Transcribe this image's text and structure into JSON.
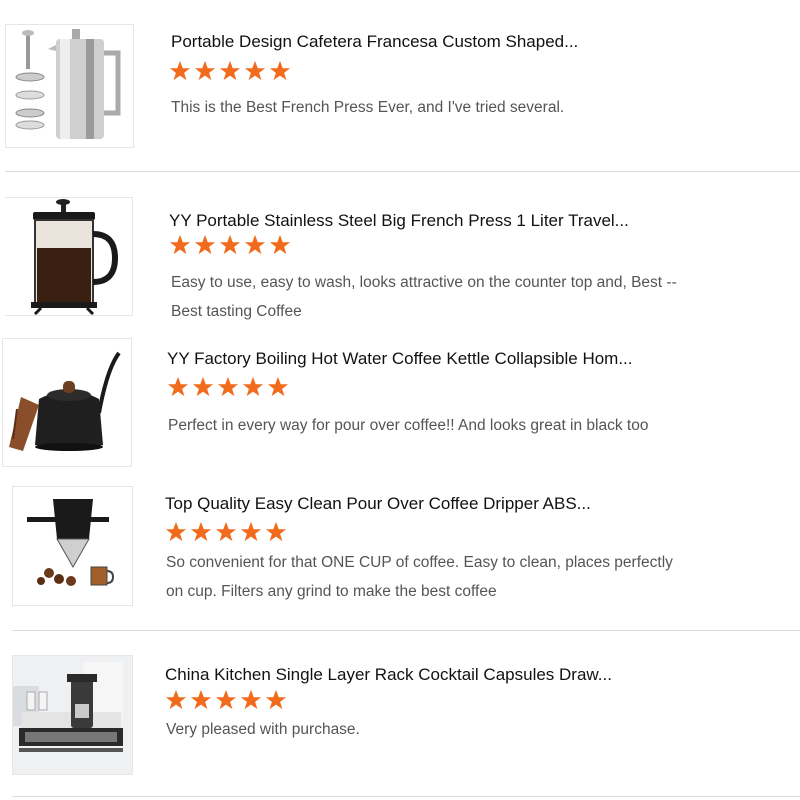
{
  "star_color": "#f26b1d",
  "products": [
    {
      "title": "Portable Design Cafetera Francesa Custom Shaped...",
      "rating": 5,
      "review": "This is the Best French Press Ever, and I've tried several.",
      "image_icon": "stainless-french-press-icon"
    },
    {
      "title": "YY Portable Stainless Steel Big French Press 1 Liter Travel...",
      "rating": 5,
      "review": "Easy to use, easy to wash, looks attractive on the counter top and, Best -- Best tasting Coffee",
      "image_icon": "glass-french-press-icon"
    },
    {
      "title": "YY Factory Boiling Hot Water Coffee Kettle Collapsible Hom...",
      "rating": 5,
      "review": "Perfect in every way for pour over coffee!! And looks great in black too",
      "image_icon": "gooseneck-kettle-icon"
    },
    {
      "title": "Top Quality Easy Clean Pour Over Coffee Dripper ABS...",
      "rating": 5,
      "review": "So convenient for that ONE CUP of coffee. Easy to clean, places perfectly on cup. Filters any grind to make the best coffee",
      "image_icon": "pour-over-dripper-icon"
    },
    {
      "title": "China Kitchen Single Layer Rack Cocktail Capsules Draw...",
      "rating": 5,
      "review": "Very pleased with purchase.",
      "image_icon": "capsule-drawer-rack-icon"
    }
  ]
}
